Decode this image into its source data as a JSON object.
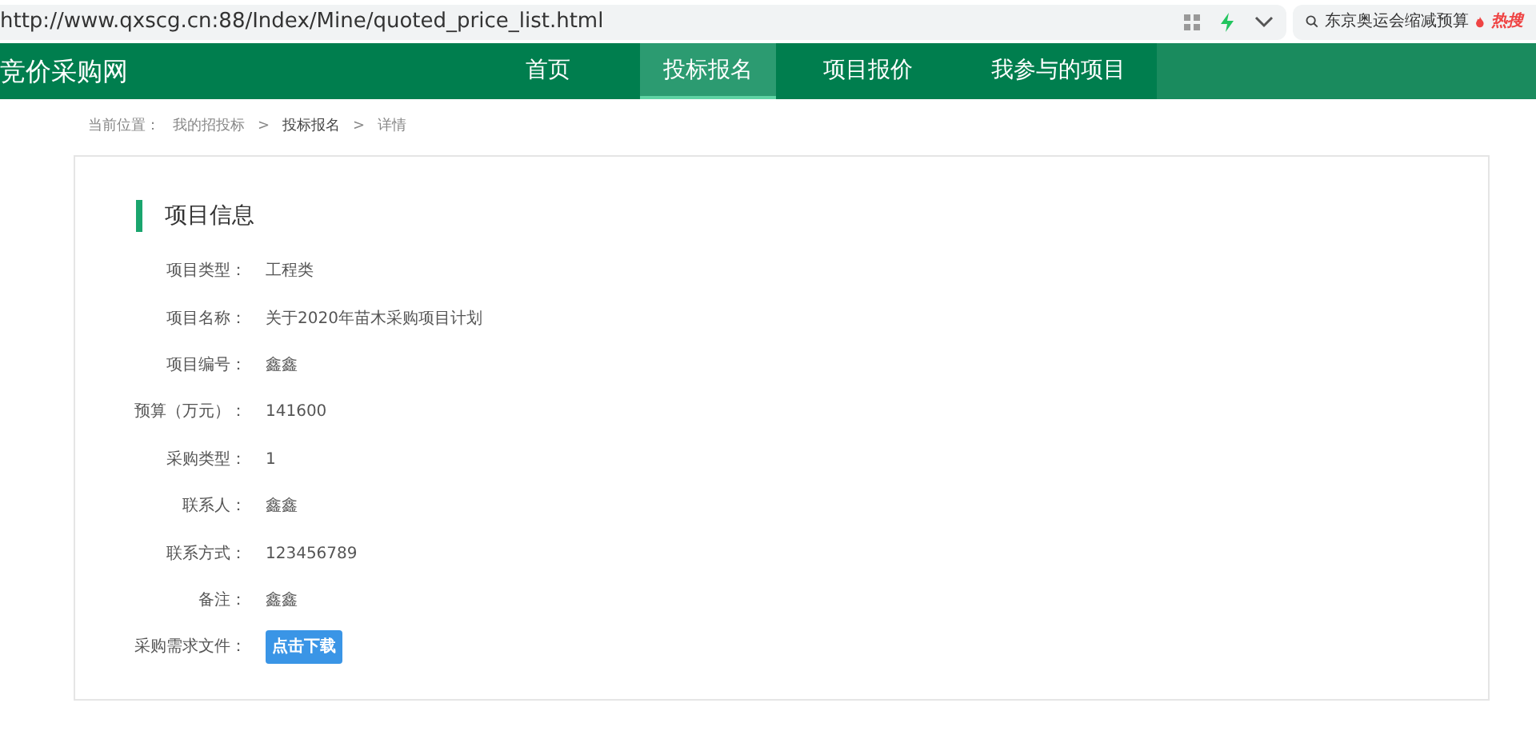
{
  "browser": {
    "url": "http://www.qxscg.cn:88/Index/Mine/quoted_price_list.html",
    "hot_search": "东京奥运会缩减预算",
    "hot_badge": "热搜"
  },
  "header": {
    "logo": "竞价采购网",
    "nav": [
      {
        "label": "首页",
        "selected": false
      },
      {
        "label": "投标报名",
        "selected": true
      },
      {
        "label": "项目报价",
        "selected": false
      },
      {
        "label": "我参与的项目",
        "selected": false
      }
    ]
  },
  "breadcrumb": {
    "prefix": "当前位置：",
    "items": [
      "我的招投标",
      "投标报名",
      "详情"
    ],
    "separator": ">"
  },
  "section": {
    "title": "项目信息",
    "fields": [
      {
        "kind": "text",
        "label": "项目类型：",
        "value": "工程类"
      },
      {
        "kind": "text",
        "label": "项目名称：",
        "value": "关于2020年苗木采购项目计划"
      },
      {
        "kind": "text",
        "label": "项目编号：",
        "value": "鑫鑫"
      },
      {
        "kind": "text",
        "label": "预算（万元）：",
        "value": "141600"
      },
      {
        "kind": "text",
        "label": "采购类型：",
        "value": "1"
      },
      {
        "kind": "text",
        "label": "联系人：",
        "value": "鑫鑫"
      },
      {
        "kind": "text",
        "label": "联系方式：",
        "value": "123456789"
      },
      {
        "kind": "text",
        "label": "备注：",
        "value": "鑫鑫"
      },
      {
        "kind": "button",
        "label": "采购需求文件：",
        "value": "点击下载"
      }
    ]
  }
}
